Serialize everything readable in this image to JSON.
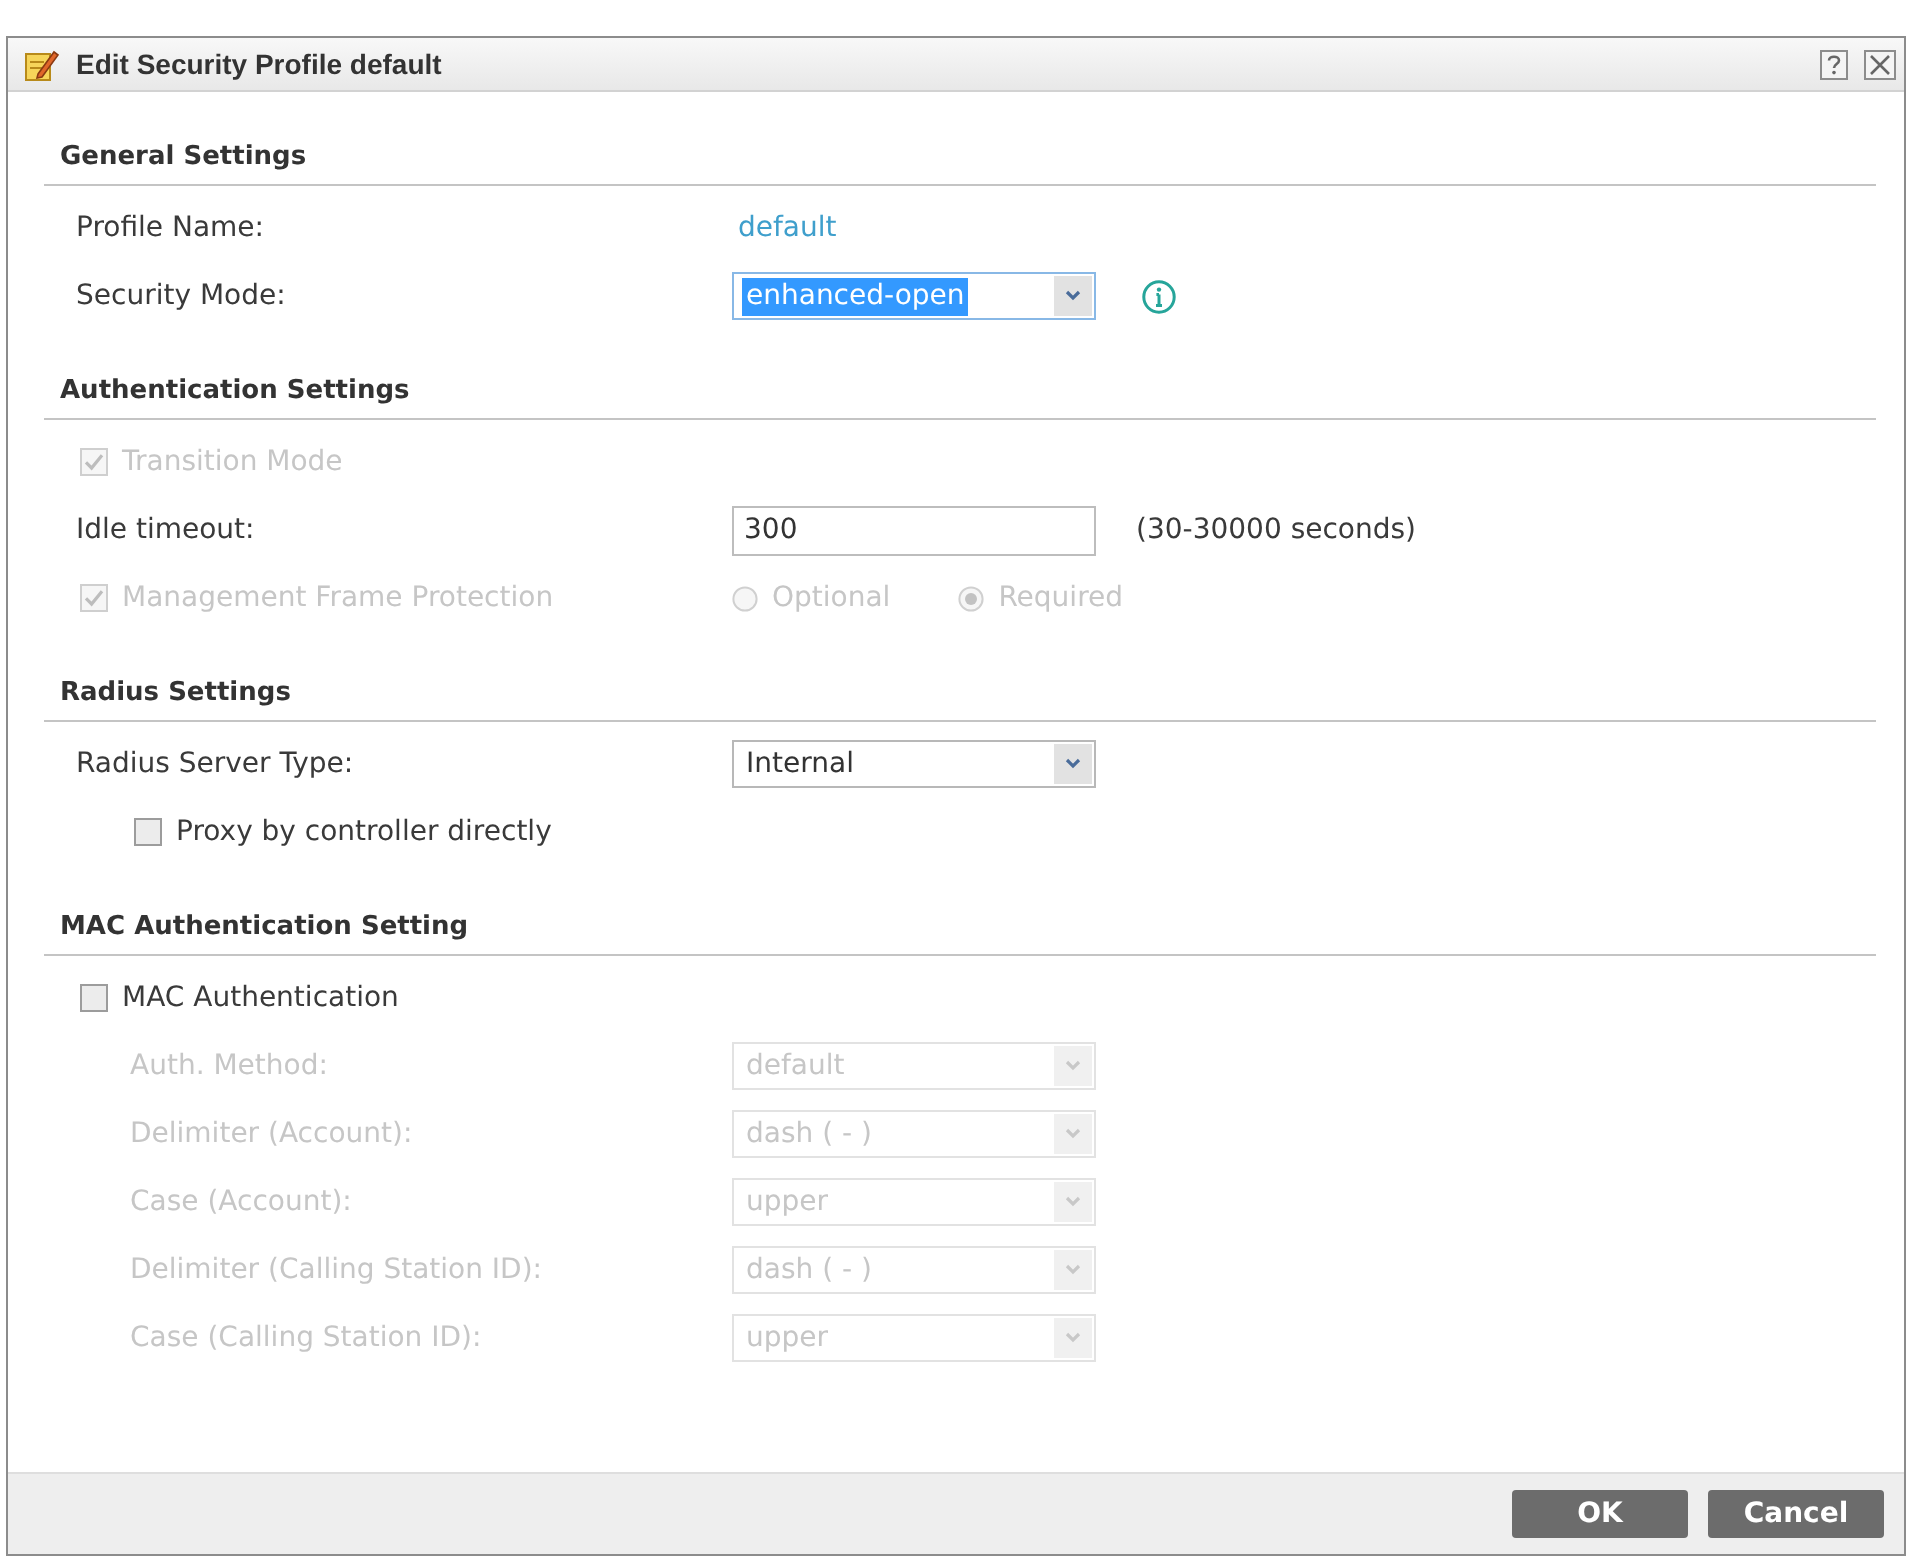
{
  "window": {
    "title": "Edit Security Profile default"
  },
  "sections": [
    {
      "title": "General Settings",
      "rows": [
        {
          "kind": "text",
          "label": "Profile Name:",
          "value": "default",
          "disabled": false
        },
        {
          "kind": "select",
          "label": "Security Mode:",
          "value": "enhanced-open",
          "disabled": false,
          "focused": true,
          "info": true
        }
      ]
    },
    {
      "title": "Authentication Settings",
      "rows": [
        {
          "kind": "checkbox",
          "label": "Transition Mode",
          "checked": true,
          "disabled": true
        },
        {
          "kind": "input",
          "label": "Idle timeout:",
          "value": "300",
          "hint": "(30-30000 seconds)",
          "disabled": false
        },
        {
          "kind": "checkbox",
          "label": "Management Frame Protection",
          "checked": true,
          "disabled": true,
          "options": [
            {
              "label": "Optional",
              "selected": false
            },
            {
              "label": "Required",
              "selected": true
            }
          ]
        }
      ]
    },
    {
      "title": "Radius Settings",
      "rows": [
        {
          "kind": "select",
          "label": "Radius Server Type:",
          "value": "Internal",
          "disabled": false,
          "focused": false,
          "info": false,
          "children": [
            {
              "kind": "checkbox",
              "label": "Proxy by controller directly",
              "checked": false,
              "disabled": false
            }
          ]
        }
      ]
    },
    {
      "title": "MAC Authentication Setting",
      "rows": [
        {
          "kind": "checkbox",
          "label": "MAC Authentication",
          "checked": false,
          "disabled": false,
          "children": [
            {
              "kind": "select",
              "label": "Auth. Method:",
              "value": "default",
              "disabled": true,
              "focused": false,
              "info": false
            },
            {
              "kind": "select",
              "label": "Delimiter (Account):",
              "value": "dash ( - )",
              "disabled": true,
              "focused": false,
              "info": false
            },
            {
              "kind": "select",
              "label": "Case (Account):",
              "value": "upper",
              "disabled": true,
              "focused": false,
              "info": false
            },
            {
              "kind": "select",
              "label": "Delimiter (Calling Station ID):",
              "value": "dash ( - )",
              "disabled": true,
              "focused": false,
              "info": false
            },
            {
              "kind": "select",
              "label": "Case (Calling Station ID):",
              "value": "upper",
              "disabled": true,
              "focused": false,
              "info": false
            }
          ]
        }
      ]
    }
  ],
  "buttons": [
    {
      "label": "OK"
    },
    {
      "label": "Cancel"
    }
  ]
}
